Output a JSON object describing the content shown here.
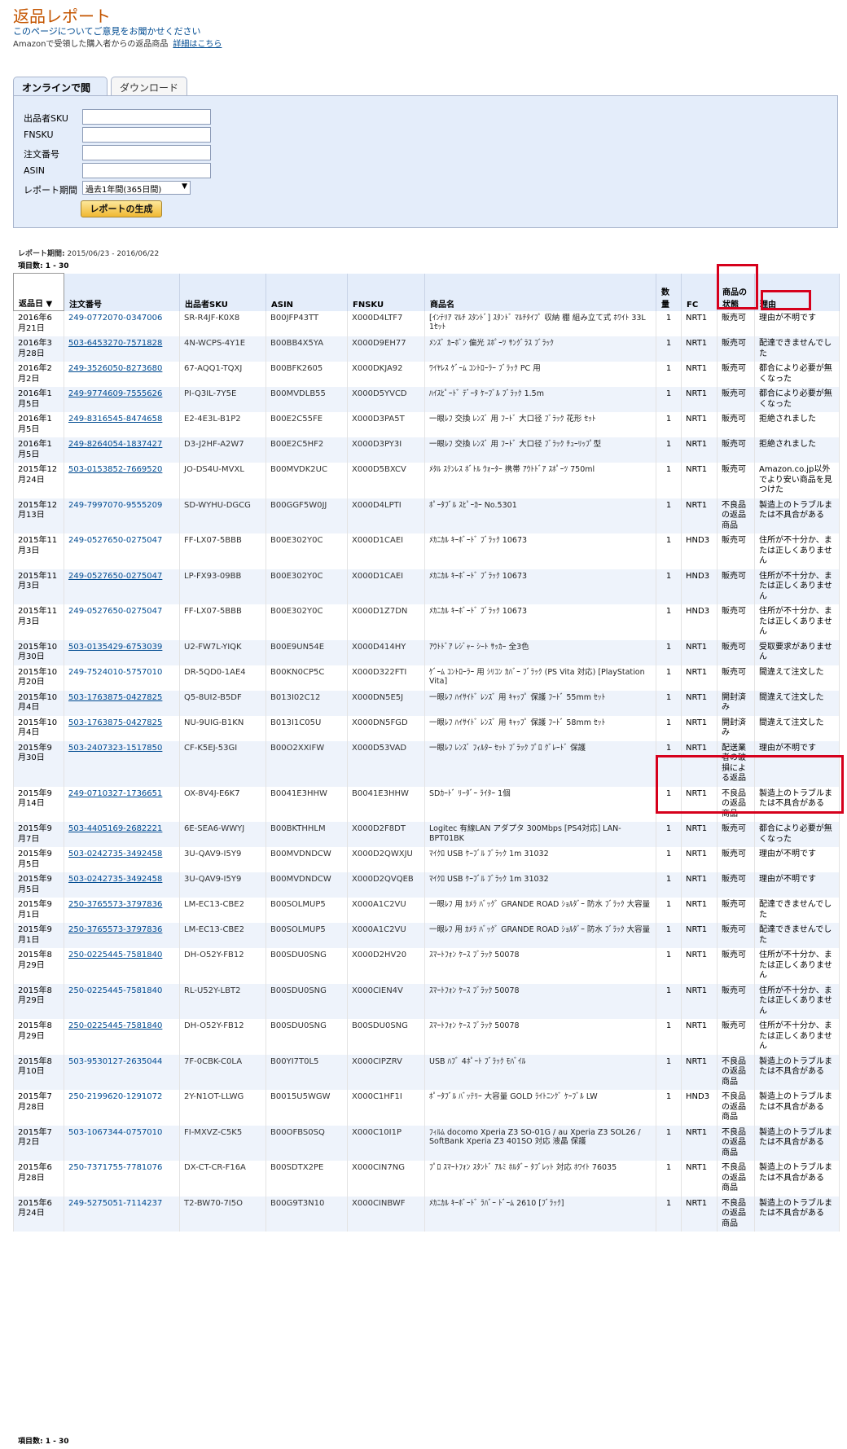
{
  "page": {
    "title": "返品レポート",
    "feedback_link": "このページについてご意見をお聞かせください",
    "description": "Amazonで受領した購入者からの返品商品",
    "details_link": "詳細はこちら"
  },
  "tabs": [
    {
      "label": "オンラインで閲覧",
      "active": true
    },
    {
      "label": "ダウンロード",
      "active": false
    }
  ],
  "form": {
    "fields": [
      {
        "label": "出品者SKU",
        "value": ""
      },
      {
        "label": "FNSKU",
        "value": ""
      },
      {
        "label": "注文番号",
        "value": ""
      },
      {
        "label": "ASIN",
        "value": ""
      }
    ],
    "period_label": "レポート期間",
    "period_value": "過去1年間(365日間)",
    "generate_button": "レポートの生成"
  },
  "report": {
    "period_label": "レポート期間:",
    "period_value": "2015/06/23 - 2016/06/22",
    "count_label": "項目数: 1 - 30"
  },
  "table": {
    "headers": {
      "date": "返品日",
      "order": "注文番号",
      "sku": "出品者SKU",
      "asin": "ASIN",
      "fnsku": "FNSKU",
      "product": "商品名",
      "qty": "数量",
      "fc": "FC",
      "condition": "商品の状態",
      "reason": "理由"
    },
    "rows": [
      {
        "date": "2016年6月21日",
        "order": "249-0772070-0347006",
        "sku": "SR-R4JF-K0X8",
        "asin": "B00JFP43TT",
        "fnsku": "X000D4LTF7",
        "product": "[ｲﾝﾃﾘｱ ﾏﾙﾁ ｽﾀﾝﾄﾞ] ｽﾀﾝﾄﾞ ﾏﾙﾁﾀｲﾌﾟ 収納 棚 組み立て式 ﾎﾜｲﾄ 33L 1ｾｯﾄ",
        "qty": "1",
        "fc": "NRT1",
        "condition": "販売可",
        "reason": "理由が不明です",
        "order_style": "plainlink"
      },
      {
        "date": "2016年3月28日",
        "order": "503-6453270-7571828",
        "sku": "4N-WCPS-4Y1E",
        "asin": "B00BB4X5YA",
        "fnsku": "X000D9EH77",
        "product": "ﾒﾝｽﾞ ｶｰﾎﾞﾝ 偏光 ｽﾎﾟｰﾂ ｻﾝｸﾞﾗｽ ﾌﾞﾗｯｸ",
        "qty": "1",
        "fc": "NRT1",
        "condition": "販売可",
        "reason": "配達できませんでした",
        "order_style": "link"
      },
      {
        "date": "2016年2月2日",
        "order": "249-3526050-8273680",
        "sku": "67-AQQ1-TQXJ",
        "asin": "B00BFK2605",
        "fnsku": "X000DKJA92",
        "product": "ﾜｲﾔﾚｽ ｹﾞｰﾑ ｺﾝﾄﾛｰﾗｰ ﾌﾞﾗｯｸ PC 用",
        "qty": "1",
        "fc": "NRT1",
        "condition": "販売可",
        "reason": "都合により必要が無くなった",
        "order_style": "link"
      },
      {
        "date": "2016年1月5日",
        "order": "249-9774609-7555626",
        "sku": "PI-Q3IL-7Y5E",
        "asin": "B00MVDLB55",
        "fnsku": "X000D5YVCD",
        "product": "ﾊｲｽﾋﾟｰﾄﾞ ﾃﾞｰﾀ ｹｰﾌﾞﾙ ﾌﾞﾗｯｸ 1.5m",
        "qty": "1",
        "fc": "NRT1",
        "condition": "販売可",
        "reason": "都合により必要が無くなった",
        "order_style": "link"
      },
      {
        "date": "2016年1月5日",
        "order": "249-8316545-8474658",
        "sku": "E2-4E3L-B1P2",
        "asin": "B00E2C55FE",
        "fnsku": "X000D3PA5T",
        "product": "一眼ﾚﾌ 交換 ﾚﾝｽﾞ 用 ﾌｰﾄﾞ 大口径 ﾌﾞﾗｯｸ 花形 ｾｯﾄ",
        "qty": "1",
        "fc": "NRT1",
        "condition": "販売可",
        "reason": "拒絶されました",
        "order_style": "link"
      },
      {
        "date": "2016年1月5日",
        "order": "249-8264054-1837427",
        "sku": "D3-J2HF-A2W7",
        "asin": "B00E2C5HF2",
        "fnsku": "X000D3PY3I",
        "product": "一眼ﾚﾌ 交換 ﾚﾝｽﾞ 用 ﾌｰﾄﾞ 大口径 ﾌﾞﾗｯｸ ﾁｭｰﾘｯﾌﾟ型",
        "qty": "1",
        "fc": "NRT1",
        "condition": "販売可",
        "reason": "拒絶されました",
        "order_style": "link"
      },
      {
        "date": "2015年12月24日",
        "order": "503-0153852-7669520",
        "sku": "JO-DS4U-MVXL",
        "asin": "B00MVDK2UC",
        "fnsku": "X000D5BXCV",
        "product": "ﾒﾀﾙ ｽﾃﾝﾚｽ ﾎﾞﾄﾙ ｳｫｰﾀｰ 携帯 ｱｳﾄﾄﾞｱ ｽﾎﾟｰﾂ 750ml",
        "qty": "1",
        "fc": "NRT1",
        "condition": "販売可",
        "reason": "Amazon.co.jp以外でより安い商品を見つけた",
        "order_style": "link"
      },
      {
        "date": "2015年12月13日",
        "order": "249-7997070-9555209",
        "sku": "SD-WYHU-DGCG",
        "asin": "B00GGF5W0JJ",
        "fnsku": "X000D4LPTI",
        "product": "ﾎﾟｰﾀﾌﾞﾙ ｽﾋﾟｰｶｰ No.5301",
        "qty": "1",
        "fc": "NRT1",
        "condition": "不良品の返品商品",
        "reason": "製造上のトラブルまたは不具合がある",
        "order_style": "plainlink"
      },
      {
        "date": "2015年11月3日",
        "order": "249-0527650-0275047",
        "sku": "FF-LX07-5BBB",
        "asin": "B00E302Y0C",
        "fnsku": "X000D1CAEI",
        "product": "ﾒｶﾆｶﾙ ｷｰﾎﾞｰﾄﾞ ﾌﾞﾗｯｸ 10673",
        "qty": "1",
        "fc": "HND3",
        "condition": "販売可",
        "reason": "住所が不十分か、または正しくありません",
        "order_style": "plainlink"
      },
      {
        "date": "2015年11月3日",
        "order": "249-0527650-0275047",
        "sku": "LP-FX93-09BB",
        "asin": "B00E302Y0C",
        "fnsku": "X000D1CAEI",
        "product": "ﾒｶﾆｶﾙ ｷｰﾎﾞｰﾄﾞ ﾌﾞﾗｯｸ 10673",
        "qty": "1",
        "fc": "HND3",
        "condition": "販売可",
        "reason": "住所が不十分か、または正しくありません",
        "order_style": "link"
      },
      {
        "date": "2015年11月3日",
        "order": "249-0527650-0275047",
        "sku": "FF-LX07-5BBB",
        "asin": "B00E302Y0C",
        "fnsku": "X000D1Z7DN",
        "product": "ﾒｶﾆｶﾙ ｷｰﾎﾞｰﾄﾞ ﾌﾞﾗｯｸ 10673",
        "qty": "1",
        "fc": "HND3",
        "condition": "販売可",
        "reason": "住所が不十分か、または正しくありません",
        "order_style": "plainlink"
      },
      {
        "date": "2015年10月30日",
        "order": "503-0135429-6753039",
        "sku": "U2-FW7L-YIQK",
        "asin": "B00E9UN54E",
        "fnsku": "X000D414HY",
        "product": "ｱｳﾄﾄﾞｱ ﾚｼﾞｬｰ ｼｰﾄ ｻｯｶｰ 全3色",
        "qty": "1",
        "fc": "NRT1",
        "condition": "販売可",
        "reason": "受取要求がありません",
        "order_style": "link"
      },
      {
        "date": "2015年10月20日",
        "order": "249-7524010-5757010",
        "sku": "DR-5QD0-1AE4",
        "asin": "B00KN0CP5C",
        "fnsku": "X000D322FTI",
        "product": "ｹﾞｰﾑ ｺﾝﾄﾛｰﾗｰ 用 ｼﾘｺﾝ ｶﾊﾞｰ ﾌﾞﾗｯｸ (PS Vita 対応) [PlayStation Vita]",
        "qty": "1",
        "fc": "NRT1",
        "condition": "販売可",
        "reason": "間違えて注文した",
        "order_style": "plainlink"
      },
      {
        "date": "2015年10月4日",
        "order": "503-1763875-0427825",
        "sku": "Q5-8UI2-B5DF",
        "asin": "B013I02C12",
        "fnsku": "X000DN5E5J",
        "product": "一眼ﾚﾌ ﾊｲｻｲﾄﾞ ﾚﾝｽﾞ 用 ｷｬｯﾌﾟ 保護 ﾌｰﾄﾞ 55mm ｾｯﾄ",
        "qty": "1",
        "fc": "NRT1",
        "condition": "開封済み",
        "reason": "間違えて注文した",
        "order_style": "link"
      },
      {
        "date": "2015年10月4日",
        "order": "503-1763875-0427825",
        "sku": "NU-9UIG-B1KN",
        "asin": "B013I1C05U",
        "fnsku": "X000DN5FGD",
        "product": "一眼ﾚﾌ ﾊｲｻｲﾄﾞ ﾚﾝｽﾞ 用 ｷｬｯﾌﾟ 保護 ﾌｰﾄﾞ 58mm ｾｯﾄ",
        "qty": "1",
        "fc": "NRT1",
        "condition": "開封済み",
        "reason": "間違えて注文した",
        "order_style": "link"
      },
      {
        "date": "2015年9月30日",
        "order": "503-2407323-1517850",
        "sku": "CF-K5EJ-53GI",
        "asin": "B00O2XXIFW",
        "fnsku": "X000D53VAD",
        "product": "一眼ﾚﾌ ﾚﾝｽﾞ ﾌｨﾙﾀｰ ｾｯﾄ ﾌﾞﾗｯｸ ﾌﾟﾛ ｸﾞﾚｰﾄﾞ 保護",
        "qty": "1",
        "fc": "NRT1",
        "condition": "配送業者の破損による返品",
        "reason": "理由が不明です",
        "order_style": "link"
      },
      {
        "date": "2015年9月14日",
        "order": "249-0710327-1736651",
        "sku": "OX-8V4J-E6K7",
        "asin": "B0041E3HHW",
        "fnsku": "B0041E3HHW",
        "product": "SDｶｰﾄﾞ ﾘｰﾀﾞｰ ﾗｲﾀｰ 1個",
        "qty": "1",
        "fc": "NRT1",
        "condition": "不良品の返品商品",
        "reason": "製造上のトラブルまたは不具合がある",
        "order_style": "link"
      },
      {
        "date": "2015年9月7日",
        "order": "503-4405169-2682221",
        "sku": "6E-SEA6-WWYJ",
        "asin": "B00BKTHHLM",
        "fnsku": "X000D2F8DT",
        "product": "Logitec 有線LAN アダプタ 300Mbps [PS4対応] LAN-BPT01BK",
        "qty": "1",
        "fc": "NRT1",
        "condition": "販売可",
        "reason": "都合により必要が無くなった",
        "order_style": "link"
      },
      {
        "date": "2015年9月5日",
        "order": "503-0242735-3492458",
        "sku": "3U-QAV9-I5Y9",
        "asin": "B00MVDNDCW",
        "fnsku": "X000D2QWXJU",
        "product": "ﾏｲｸﾛ USB ｹｰﾌﾞﾙ ﾌﾞﾗｯｸ 1m 31032",
        "qty": "1",
        "fc": "NRT1",
        "condition": "販売可",
        "reason": "理由が不明です",
        "order_style": "link"
      },
      {
        "date": "2015年9月5日",
        "order": "503-0242735-3492458",
        "sku": "3U-QAV9-I5Y9",
        "asin": "B00MVDNDCW",
        "fnsku": "X000D2QVQEB",
        "product": "ﾏｲｸﾛ USB ｹｰﾌﾞﾙ ﾌﾞﾗｯｸ 1m 31032",
        "qty": "1",
        "fc": "NRT1",
        "condition": "販売可",
        "reason": "理由が不明です",
        "order_style": "link"
      },
      {
        "date": "2015年9月1日",
        "order": "250-3765573-3797836",
        "sku": "LM-EC13-CBE2",
        "asin": "B00SOLMUP5",
        "fnsku": "X000A1C2VU",
        "product": "一眼ﾚﾌ 用 ｶﾒﾗ ﾊﾞｯｸﾞ GRANDE ROAD ｼｮﾙﾀﾞｰ 防水 ﾌﾞﾗｯｸ 大容量",
        "qty": "1",
        "fc": "NRT1",
        "condition": "販売可",
        "reason": "配達できませんでした",
        "order_style": "link"
      },
      {
        "date": "2015年9月1日",
        "order": "250-3765573-3797836",
        "sku": "LM-EC13-CBE2",
        "asin": "B00SOLMUP5",
        "fnsku": "X000A1C2VU",
        "product": "一眼ﾚﾌ 用 ｶﾒﾗ ﾊﾞｯｸﾞ GRANDE ROAD ｼｮﾙﾀﾞｰ 防水 ﾌﾞﾗｯｸ 大容量",
        "qty": "1",
        "fc": "NRT1",
        "condition": "販売可",
        "reason": "配達できませんでした",
        "order_style": "link"
      },
      {
        "date": "2015年8月29日",
        "order": "250-0225445-7581840",
        "sku": "DH-O52Y-FB12",
        "asin": "B00SDU0SNG",
        "fnsku": "X000D2HV20",
        "product": "ｽﾏｰﾄﾌｫﾝ ｹｰｽ ﾌﾞﾗｯｸ 50078",
        "qty": "1",
        "fc": "NRT1",
        "condition": "販売可",
        "reason": "住所が不十分か、または正しくありません",
        "order_style": "link"
      },
      {
        "date": "2015年8月29日",
        "order": "250-0225445-7581840",
        "sku": "RL-U52Y-LBT2",
        "asin": "B00SDU0SNG",
        "fnsku": "X000CIEN4V",
        "product": "ｽﾏｰﾄﾌｫﾝ ｹｰｽ ﾌﾞﾗｯｸ 50078",
        "qty": "1",
        "fc": "NRT1",
        "condition": "販売可",
        "reason": "住所が不十分か、または正しくありません",
        "order_style": "plainlink"
      },
      {
        "date": "2015年8月29日",
        "order": "250-0225445-7581840",
        "sku": "DH-O52Y-FB12",
        "asin": "B00SDU0SNG",
        "fnsku": "B00SDU0SNG",
        "product": "ｽﾏｰﾄﾌｫﾝ ｹｰｽ ﾌﾞﾗｯｸ 50078",
        "qty": "1",
        "fc": "NRT1",
        "condition": "販売可",
        "reason": "住所が不十分か、または正しくありません",
        "order_style": "link"
      },
      {
        "date": "2015年8月10日",
        "order": "503-9530127-2635044",
        "sku": "7F-0CBK-C0LA",
        "asin": "B00YI7T0L5",
        "fnsku": "X000CIPZRV",
        "product": "USB ﾊﾌﾞ 4ﾎﾟｰﾄ ﾌﾞﾗｯｸ ﾓﾊﾞｲﾙ",
        "qty": "1",
        "fc": "NRT1",
        "condition": "不良品の返品商品",
        "reason": "製造上のトラブルまたは不具合がある",
        "order_style": "plainlink"
      },
      {
        "date": "2015年7月28日",
        "order": "250-2199620-1291072",
        "sku": "2Y-N1OT-LLWG",
        "asin": "B0015U5WGW",
        "fnsku": "X000C1HF1I",
        "product": "ﾎﾟｰﾀﾌﾞﾙ ﾊﾞｯﾃﾘｰ 大容量 GOLD ﾗｲﾄﾆﾝｸﾞ ｹｰﾌﾞﾙ LW",
        "qty": "1",
        "fc": "HND3",
        "condition": "不良品の返品商品",
        "reason": "製造上のトラブルまたは不具合がある",
        "order_style": "plainlink"
      },
      {
        "date": "2015年7月2日",
        "order": "503-1067344-0757010",
        "sku": "FI-MXVZ-C5K5",
        "asin": "B00OFBS0SQ",
        "fnsku": "X000C10I1P",
        "product": "ﾌｨﾙﾑ docomo Xperia Z3 SO-01G / au Xperia Z3 SOL26 / SoftBank Xperia Z3 401SO 対応 液晶 保護",
        "qty": "1",
        "fc": "NRT1",
        "condition": "不良品の返品商品",
        "reason": "製造上のトラブルまたは不具合がある",
        "order_style": "plainlink"
      },
      {
        "date": "2015年6月28日",
        "order": "250-7371755-7781076",
        "sku": "DX-CT-CR-F16A",
        "asin": "B00SDTX2PE",
        "fnsku": "X000CIN7NG",
        "product": "ﾌﾟﾛ ｽﾏｰﾄﾌｫﾝ ｽﾀﾝﾄﾞ ｱﾙﾐ ﾎﾙﾀﾞｰ ﾀﾌﾞﾚｯﾄ 対応 ﾎﾜｲﾄ 76035",
        "qty": "1",
        "fc": "NRT1",
        "condition": "不良品の返品商品",
        "reason": "製造上のトラブルまたは不具合がある",
        "order_style": "plainlink"
      },
      {
        "date": "2015年6月24日",
        "order": "249-5275051-7114237",
        "sku": "T2-BW70-7I5O",
        "asin": "B00G9T3N10",
        "fnsku": "X000CINBWF",
        "product": "ﾒｶﾆｶﾙ ｷｰﾎﾞｰﾄﾞ ﾗﾊﾞｰ ﾄﾞｰﾑ 2610 [ﾌﾞﾗｯｸ]",
        "qty": "1",
        "fc": "NRT1",
        "condition": "不良品の返品商品",
        "reason": "製造上のトラブルまたは不具合がある",
        "order_style": "plainlink"
      }
    ]
  }
}
